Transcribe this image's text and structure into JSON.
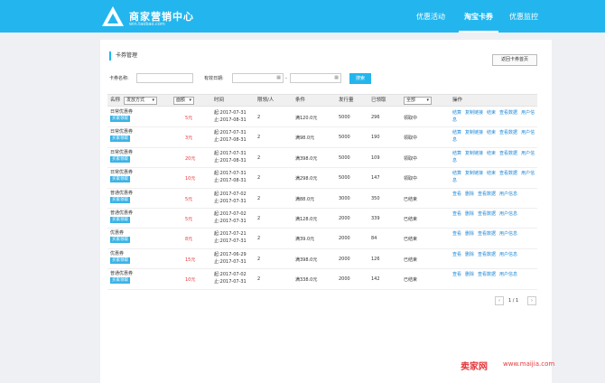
{
  "header": {
    "title": "商家营销中心",
    "subtitle": "win.taobao.com",
    "nav": [
      "优惠活动",
      "淘宝卡券",
      "优惠监控"
    ]
  },
  "page": {
    "section_title": "卡券管理",
    "back_button": "返回卡券首页"
  },
  "filters": {
    "name_label": "卡券名称:",
    "date_label": "有效日期:",
    "date_sep": "-",
    "search_button": "搜索"
  },
  "table": {
    "headers": {
      "name": "名称",
      "issue_mode": "发放方式",
      "amount": "面额",
      "time": "时间",
      "limit": "限领/人",
      "condition": "条件",
      "issued": "发行量",
      "claimed": "已领取",
      "status_filter": "全部",
      "ops": "操作"
    },
    "rows": [
      {
        "name": "日常优惠券",
        "tag": "买家领取",
        "amount": "5元",
        "start": "起:2017-07-31",
        "end": "止:2017-08-31",
        "limit": "2",
        "cond": "满120.0元",
        "issued": "5000",
        "claimed": "296",
        "status": "领取中",
        "ops": [
          "结算",
          "复制链接",
          "结束",
          "查看数据",
          "用户信息"
        ]
      },
      {
        "name": "日常优惠券",
        "tag": "买家领取",
        "amount": "3元",
        "start": "起:2017-07-31",
        "end": "止:2017-08-31",
        "limit": "2",
        "cond": "满98.0元",
        "issued": "5000",
        "claimed": "190",
        "status": "领取中",
        "ops": [
          "结算",
          "复制链接",
          "结束",
          "查看数据",
          "用户信息"
        ]
      },
      {
        "name": "日常优惠券",
        "tag": "买家领取",
        "amount": "20元",
        "start": "起:2017-07-31",
        "end": "止:2017-08-31",
        "limit": "2",
        "cond": "满398.0元",
        "issued": "5000",
        "claimed": "109",
        "status": "领取中",
        "ops": [
          "结算",
          "复制链接",
          "结束",
          "查看数据",
          "用户信息"
        ]
      },
      {
        "name": "日常优惠券",
        "tag": "买家领取",
        "amount": "10元",
        "start": "起:2017-07-31",
        "end": "止:2017-08-31",
        "limit": "2",
        "cond": "满298.0元",
        "issued": "5000",
        "claimed": "147",
        "status": "领取中",
        "ops": [
          "结算",
          "复制链接",
          "结束",
          "查看数据",
          "用户信息"
        ]
      },
      {
        "name": "普通优惠券",
        "tag": "买家领取",
        "amount": "5元",
        "start": "起:2017-07-02",
        "end": "止:2017-07-31",
        "limit": "2",
        "cond": "满88.0元",
        "issued": "3000",
        "claimed": "350",
        "status": "已结束",
        "ops": [
          "查看",
          "删除",
          "查看数据",
          "用户信息"
        ]
      },
      {
        "name": "普通优惠券",
        "tag": "买家领取",
        "amount": "5元",
        "start": "起:2017-07-02",
        "end": "止:2017-07-31",
        "limit": "2",
        "cond": "满128.0元",
        "issued": "2000",
        "claimed": "339",
        "status": "已结束",
        "ops": [
          "查看",
          "删除",
          "查看数据",
          "用户信息"
        ]
      },
      {
        "name": "优惠券",
        "tag": "买家领取",
        "amount": "8元",
        "start": "起:2017-07-21",
        "end": "止:2017-07-31",
        "limit": "2",
        "cond": "满39.0元",
        "issued": "2000",
        "claimed": "84",
        "status": "已结束",
        "ops": [
          "查看",
          "删除",
          "查看数据",
          "用户信息"
        ]
      },
      {
        "name": "优惠券",
        "tag": "买家领取",
        "amount": "15元",
        "start": "起:2017-06-29",
        "end": "止:2017-07-31",
        "limit": "2",
        "cond": "满398.0元",
        "issued": "2000",
        "claimed": "126",
        "status": "已结束",
        "ops": [
          "查看",
          "删除",
          "查看数据",
          "用户信息"
        ]
      },
      {
        "name": "普通优惠券",
        "tag": "买家领取",
        "amount": "10元",
        "start": "起:2017-07-02",
        "end": "止:2017-07-31",
        "limit": "2",
        "cond": "满338.0元",
        "issued": "2000",
        "claimed": "142",
        "status": "已结束",
        "ops": [
          "查看",
          "删除",
          "查看数据",
          "用户信息"
        ]
      }
    ]
  },
  "pagination": {
    "prev": "‹",
    "info": "1 / 1",
    "next": "›"
  },
  "watermark": {
    "brand": "卖家网",
    "url": "www.maijia.com"
  }
}
